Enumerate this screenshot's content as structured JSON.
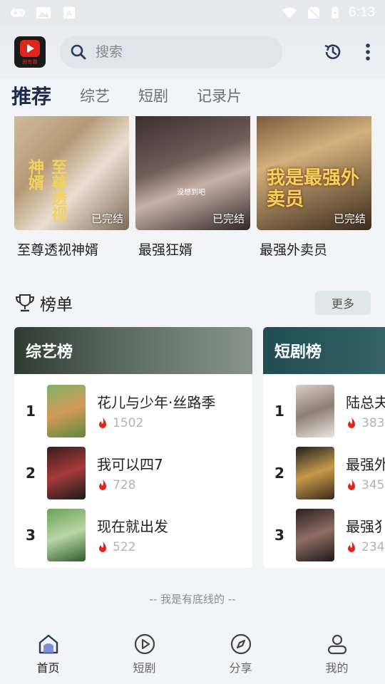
{
  "status_bar": {
    "time": "6:13",
    "left_icons": [
      "gamepad-icon",
      "image-icon",
      "font-icon"
    ],
    "right_icons": [
      "wifi-icon",
      "no-sim-icon",
      "battery-charging-icon"
    ]
  },
  "topbar": {
    "logo_text": "剧有趣",
    "search_placeholder": "搜索",
    "icons": [
      "history-icon",
      "more-vert-icon"
    ]
  },
  "tabs": [
    {
      "label": "推荐",
      "active": true
    },
    {
      "label": "综艺",
      "active": false
    },
    {
      "label": "短剧",
      "active": false
    },
    {
      "label": "记录片",
      "active": false
    }
  ],
  "dramas": [
    {
      "title": "至尊透视神婿",
      "badge": "已完结",
      "poster_text": "至尊透视神婿"
    },
    {
      "title": "最强狂婿",
      "badge": "已完结",
      "poster_text": "没想到吧"
    },
    {
      "title": "最强外卖员",
      "badge": "已完结",
      "poster_text": "我是最强外卖员"
    }
  ],
  "ranking": {
    "title": "榜单",
    "more_label": "更多",
    "cards": [
      {
        "name": "综艺榜",
        "items": [
          {
            "rank": "1",
            "title": "花儿与少年·丝路季",
            "hot": "1502"
          },
          {
            "rank": "2",
            "title": "我可以四7",
            "hot": "728"
          },
          {
            "rank": "3",
            "title": "现在就出发",
            "hot": "522"
          }
        ]
      },
      {
        "name": "短剧榜",
        "items": [
          {
            "rank": "1",
            "title": "陆总夫",
            "hot": "383"
          },
          {
            "rank": "2",
            "title": "最强外",
            "hot": "345"
          },
          {
            "rank": "3",
            "title": "最强犭",
            "hot": "234"
          }
        ]
      }
    ]
  },
  "footer_note": "-- 我是有底线的 --",
  "bottom_nav": [
    {
      "label": "首页",
      "icon": "home-icon",
      "active": true
    },
    {
      "label": "短剧",
      "icon": "play-circle-icon",
      "active": false
    },
    {
      "label": "分享",
      "icon": "compass-icon",
      "active": false
    },
    {
      "label": "我的",
      "icon": "user-icon",
      "active": false
    }
  ],
  "colors": {
    "accent_navy": "#1b2a4f",
    "hot_red": "#e0261b",
    "background": "#f3f4f7"
  }
}
